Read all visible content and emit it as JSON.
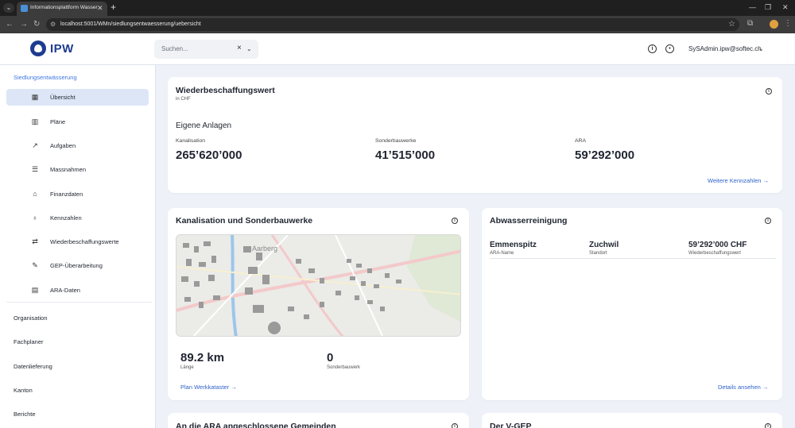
{
  "browser": {
    "tab_title": "Informationsplattform Wasser",
    "url": "localhost:5001/WMn/siedlungsentwaesserung/uebersicht"
  },
  "header": {
    "logo_text": "IPW",
    "search_placeholder": "Suchen...",
    "user": "SySAdmin.ipw@softec.ch"
  },
  "sidebar": {
    "section_title": "Siedlungsentwässerung",
    "items": [
      {
        "label": "Übersicht",
        "icon": "dashboard-icon",
        "active": true
      },
      {
        "label": "Pläne",
        "icon": "map-icon"
      },
      {
        "label": "Aufgaben",
        "icon": "arrow-up-right-icon"
      },
      {
        "label": "Massnahmen",
        "icon": "checklist-icon"
      },
      {
        "label": "Finanzdaten",
        "icon": "bank-icon"
      },
      {
        "label": "Kennzahlen",
        "icon": "piggy-bank-icon"
      },
      {
        "label": "Wiederbeschaffungswerte",
        "icon": "swap-icon"
      },
      {
        "label": "GEP-Überarbeitung",
        "icon": "person-edit-icon"
      },
      {
        "label": "ARA-Daten",
        "icon": "table-icon"
      }
    ],
    "groups": [
      "Organisation",
      "Fachplaner",
      "Datenlieferung",
      "Kanton",
      "Berichte"
    ]
  },
  "wbw_card": {
    "title": "Wiederbeschaffungswert",
    "subtitle": "in CHF",
    "section": "Eigene Anlagen",
    "kpis": [
      {
        "label": "Kanalisation",
        "value": "265’620’000"
      },
      {
        "label": "Sonderbauwerke",
        "value": "41’515’000"
      },
      {
        "label": "ARA",
        "value": "59’292’000"
      }
    ],
    "link": "Weitere Kennzahlen"
  },
  "kanal_card": {
    "title": "Kanalisation und Sonderbauwerke",
    "map_label": "Aarberg",
    "kpis": [
      {
        "value": "89.2 km",
        "label": "Länge"
      },
      {
        "value": "0",
        "label": "Sonderbauwerk"
      }
    ],
    "link": "Plan Werkkataster"
  },
  "ara_card": {
    "title": "Abwasserreinigung",
    "fields": [
      {
        "value": "Emmenspitz",
        "label": "ARA-Name"
      },
      {
        "value": "Zuchwil",
        "label": "Standort"
      },
      {
        "value": "59’292’000 CHF",
        "label": "Wiederbeschaffungswert"
      }
    ],
    "link": "Details ansehen"
  },
  "bottom_cards": {
    "left_title": "An die ARA angeschlossene Gemeinden",
    "right_title": "Der V-GEP"
  }
}
